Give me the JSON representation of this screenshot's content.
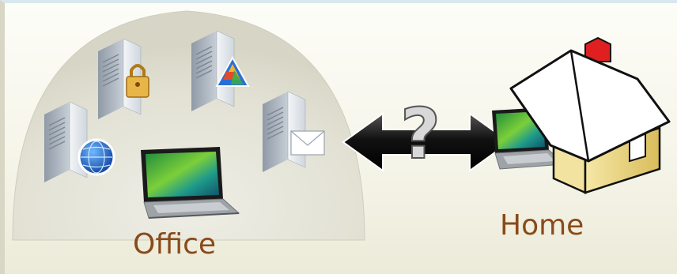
{
  "labels": {
    "office": "Office",
    "home": "Home"
  },
  "connection_symbol": "?",
  "icons": [
    "server-globe-icon",
    "server-lock-icon",
    "server-app-icon",
    "server-mail-icon",
    "office-laptop-icon",
    "home-laptop-icon",
    "house-icon",
    "bidirectional-arrow-icon"
  ],
  "colors": {
    "label_text": "#8a4a1a",
    "dome": "#e4e3d6",
    "house_walls": "#ecd88a",
    "house_roof": "#ffffff",
    "chimney": "#e02020",
    "arrow": "#111111"
  }
}
